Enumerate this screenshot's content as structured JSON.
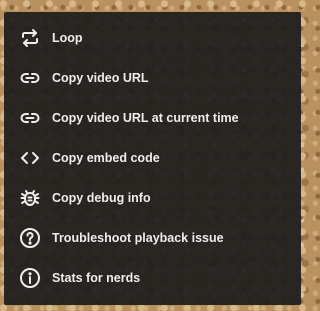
{
  "menu": {
    "items": [
      {
        "label": "Loop",
        "icon": "loop-icon"
      },
      {
        "label": "Copy video URL",
        "icon": "link-icon"
      },
      {
        "label": "Copy video URL at current time",
        "icon": "link-icon"
      },
      {
        "label": "Copy embed code",
        "icon": "code-icon"
      },
      {
        "label": "Copy debug info",
        "icon": "bug-icon"
      },
      {
        "label": "Troubleshoot playback issue",
        "icon": "help-circle-icon"
      },
      {
        "label": "Stats for nerds",
        "icon": "info-circle-icon"
      }
    ]
  },
  "colors": {
    "menu_background": "#1c1c1c",
    "text": "#eeeeee"
  }
}
